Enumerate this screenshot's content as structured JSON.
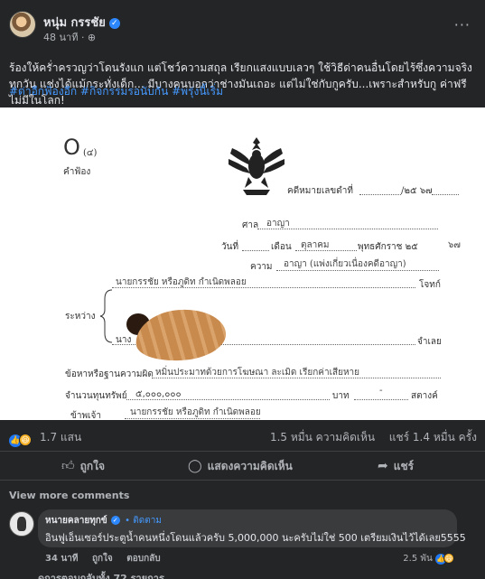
{
  "post": {
    "author": "หนุ่ม กรรชัย",
    "time": "48 นาที · ⊕",
    "more": "···",
    "text": "ร้องให้ครั่าครวญว่าโดนรังแก แต่โชว์ความสถุล เรียกแสงแบบเลวๆ ใช้วิธีด่าคนอื่นโดยไร้ซึ่งความจริงทุกวัน แช่งได้แม้กระทั่งเด็ก... มีบางคนบอกว่าช่างมันเถอะ แต่ไม่ใช่กับกูครับ...เพราะสำหรับกู ค่าฟรีไม่มีในโลก!",
    "hashtags": "#ด่าอีกฟ้องอีก #กิจกรรมรอนับกัน #พรุ่งนี้เริ่ม"
  },
  "document": {
    "form_code": "O",
    "form_num": "(๔)",
    "form_title": "คำฟ้อง",
    "case_no_label": "คดีหมายเลขดำที่",
    "case_year": "/๒๕ ๖๗",
    "court_label": "ศาล",
    "court_value": "อาญา",
    "date_label": "วันที่",
    "month_label": "เดือน",
    "month_value": "ตุลาคม",
    "year_label": "พุทธศักราช ๒๕",
    "year_value": "๖๗",
    "matter_label": "ความ",
    "matter_value": "อาญา (แพ่งเกี่ยวเนื่องคดีอาญา)",
    "plaintiff_name": "นายกรรชัย หรือภูดิท กำเนิดพลอย",
    "plaintiff_role": "โจทก์",
    "between_label": "ระหว่าง",
    "defendant_prefix": "นาง",
    "defendant_role": "จำเลย",
    "charge_label": "ข้อหาหรือฐานความผิด",
    "charge_value": "หมิ่นประมาทด้วยการโฆษณา ละเมิด เรียกค่าเสียหาย",
    "amount_label": "จำนวนทุนทรัพย์",
    "amount_value": "๕,๐๐๐,๐๐๐",
    "baht_label": "บาท",
    "dash_value": "-",
    "satang_label": "สตางค์",
    "owner_label": "ข้าพเจ้า",
    "owner_value": "นายกรรชัย หรือภูดิท กำเนิดพลอย"
  },
  "stats": {
    "reaction_count": "1.7 แสน",
    "comments": "1.5 หมื่น ความคิดเห็น",
    "shares": "แชร์ 1.4 หมื่น ครั้ง"
  },
  "actions": {
    "like": "ถูกใจ",
    "comment": "แสดงความคิดเห็น",
    "share": "แชร์"
  },
  "comments": {
    "view_more": "View more comments",
    "items": [
      {
        "author": "หนายคลายทุกข์",
        "follow": "• ติดตาม",
        "text": "อินฟูเอ็นเซอร์ประตูน้ำคนหนึ่งโดนแล้วครับ 5,000,000 นะครับไม่ใช่ 500 เตรียมเงินไว้ได้เลย5555",
        "time": "34 นาที",
        "like": "ถูกใจ",
        "reply": "ตอบกลับ",
        "reactions": "2.5 พัน"
      }
    ],
    "replies": "ดูการตอบกลับทั้ง 72 รายการ"
  },
  "icons": {
    "verified": "verified-badge-icon",
    "like": "thumbs-up-icon",
    "haha": "haha-icon",
    "comment": "comment-bubble-icon",
    "share": "share-arrow-icon",
    "emblem": "garuda-emblem-icon"
  },
  "colors": {
    "background": "#242526",
    "link": "#4599ff",
    "like": "#2078f4",
    "haha": "#f7b125",
    "text_secondary": "#b0b3b8"
  }
}
